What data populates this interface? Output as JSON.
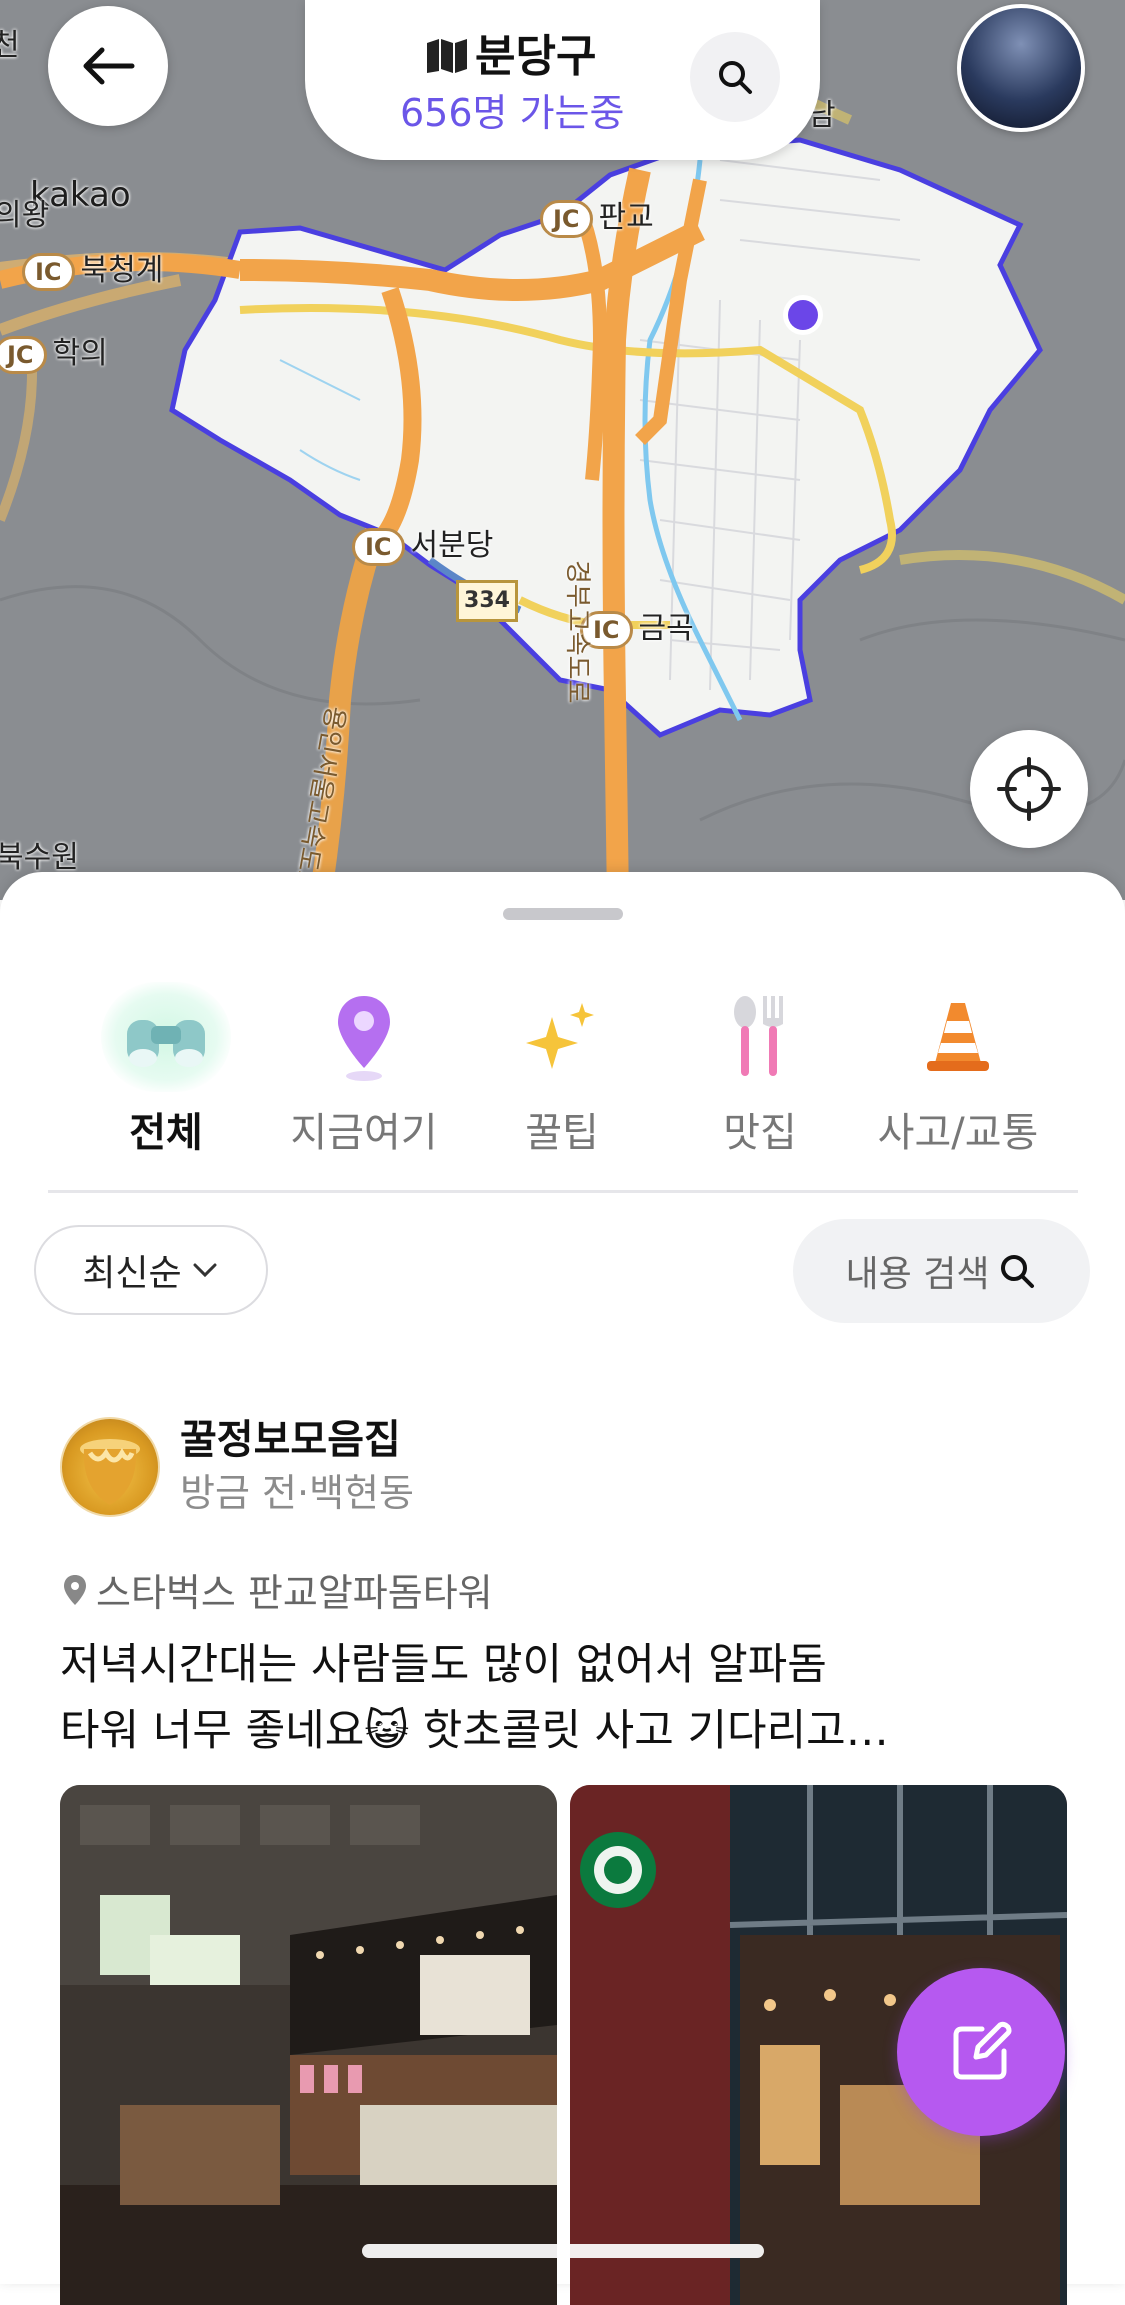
{
  "header": {
    "back_icon": "arrow-left-icon",
    "district_icon": "map-icon",
    "district": "분당구",
    "visitors": "656명 가는중",
    "search_icon": "search-icon"
  },
  "map": {
    "provider": "kakao",
    "labels": {
      "pangyo": "판교",
      "bukcheonggye": "북청계",
      "hakui": "학의",
      "seobundang": "서분당",
      "geumgok": "금곡",
      "gyeongbu": "경부고속도로",
      "yongin_seoul": "용인서울고속도로",
      "route_334": "334",
      "top_left": "천",
      "left": "의왕",
      "bottom_left": "북수원",
      "top_right": "남"
    },
    "ic": "IC",
    "jc": "JC",
    "colors": {
      "boundary": "#4a3fe0",
      "highway": "#f2a44a",
      "road": "#f2d15a",
      "river": "#7fc8ef"
    }
  },
  "tabs": [
    {
      "label": "전체",
      "icon": "binoculars-icon",
      "active": true
    },
    {
      "label": "지금여기",
      "icon": "location-pin-icon",
      "active": false
    },
    {
      "label": "꿀팁",
      "icon": "sparkles-icon",
      "active": false
    },
    {
      "label": "맛집",
      "icon": "fork-spoon-icon",
      "active": false
    },
    {
      "label": "사고/교통",
      "icon": "traffic-cone-icon",
      "active": false
    }
  ],
  "filters": {
    "sort_label": "최신순",
    "search_label": "내용 검색"
  },
  "post": {
    "author": "꿀정보모음집",
    "time": "방금 전",
    "separator": "·",
    "location": "백현동",
    "place": "스타벅스 판교알파돔타워",
    "text_line1": "저녁시간대는 사람들도 많이 없어서 알파돔",
    "text_line2": "타워 너무 좋네요",
    "emoji": "😺",
    "text_line3": " 핫초콜릿 사고 기다리고…"
  },
  "fab_icon": "edit-icon",
  "colors": {
    "accent": "#6b56e8",
    "fab": "#b659f0"
  }
}
